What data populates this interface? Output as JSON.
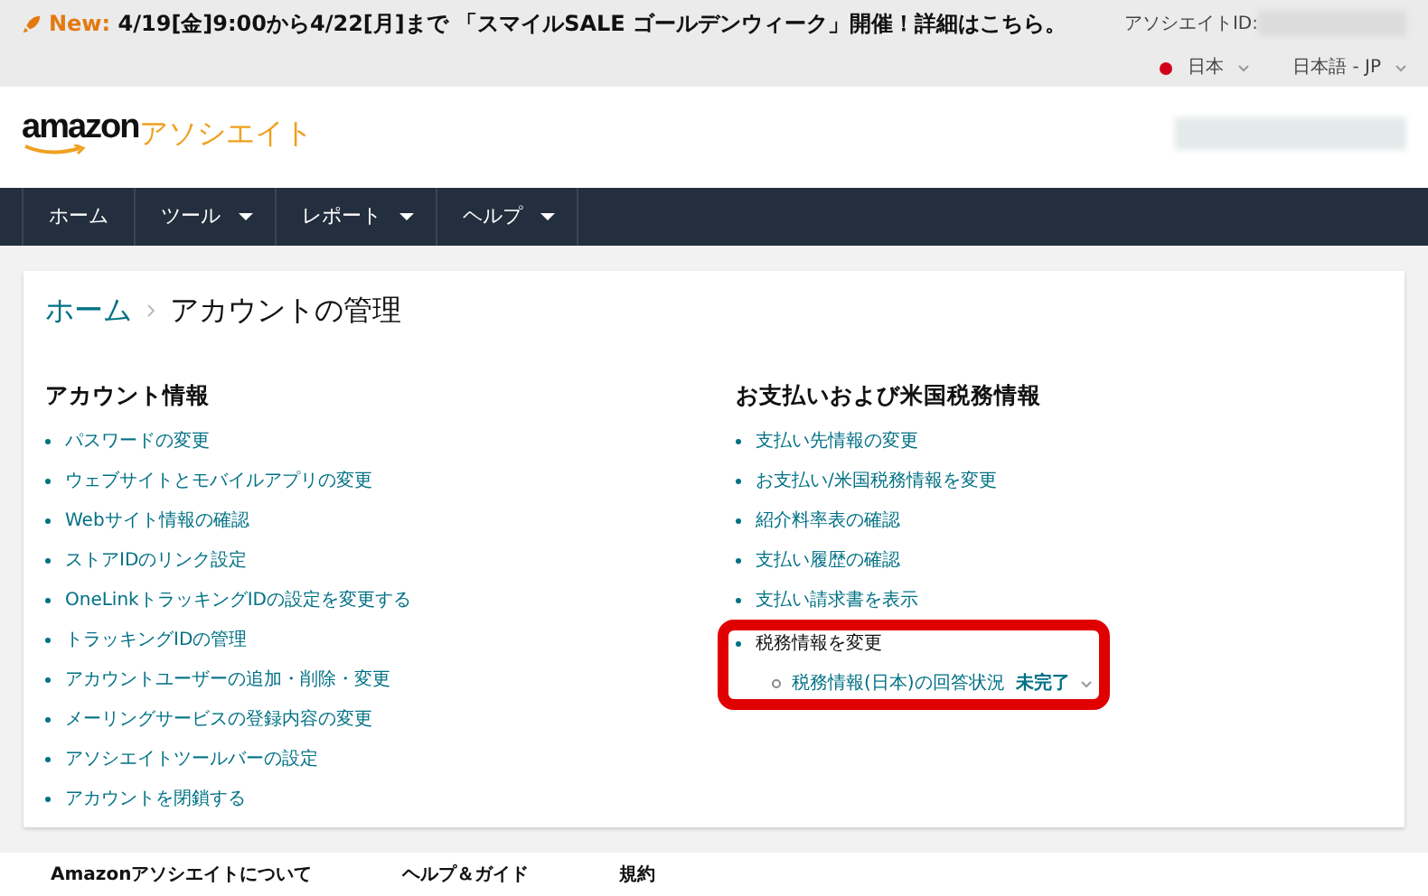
{
  "announcement": {
    "label": "New:",
    "text": "4/19[金]9:00から4/22[月]まで 「スマイルSALE ゴールデンウィーク」開催！詳細はこちら。"
  },
  "associate_id_label": "アソシエイトID:",
  "country": "日本",
  "language": "日本語 - JP",
  "logo": {
    "brand": "amazon",
    "suffix": "アソシエイト"
  },
  "nav": [
    {
      "label": "ホーム",
      "has_menu": false
    },
    {
      "label": "ツール",
      "has_menu": true
    },
    {
      "label": "レポート",
      "has_menu": true
    },
    {
      "label": "ヘルプ",
      "has_menu": true
    }
  ],
  "breadcrumb": {
    "home": "ホーム",
    "current": "アカウントの管理"
  },
  "sections": [
    {
      "title": "アカウント情報",
      "links": [
        {
          "label": "パスワードの変更"
        },
        {
          "label": "ウェブサイトとモバイルアプリの変更"
        },
        {
          "label": "Webサイト情報の確認"
        },
        {
          "label": "ストアIDのリンク設定"
        },
        {
          "label": "OneLinkトラッキングIDの設定を変更する"
        },
        {
          "label": "トラッキングIDの管理"
        },
        {
          "label": "アカウントユーザーの追加・削除・変更"
        },
        {
          "label": "メーリングサービスの登録内容の変更"
        },
        {
          "label": "アソシエイトツールバーの設定"
        },
        {
          "label": "アカウントを閉鎖する"
        }
      ]
    },
    {
      "title": "お支払いおよび米国税務情報",
      "links": [
        {
          "label": "支払い先情報の変更"
        },
        {
          "label": "お支払い/米国税務情報を変更"
        },
        {
          "label": "紹介料率表の確認"
        },
        {
          "label": "支払い履歴の確認"
        },
        {
          "label": "支払い請求書を表示"
        },
        {
          "label": "税務情報を変更",
          "highlighted": true,
          "children": [
            {
              "label": "税務情報(日本)の回答状況",
              "status": "未完了"
            }
          ]
        }
      ]
    }
  ],
  "footer": [
    "Amazonアソシエイトについて",
    "ヘルプ＆ガイド",
    "規約"
  ]
}
